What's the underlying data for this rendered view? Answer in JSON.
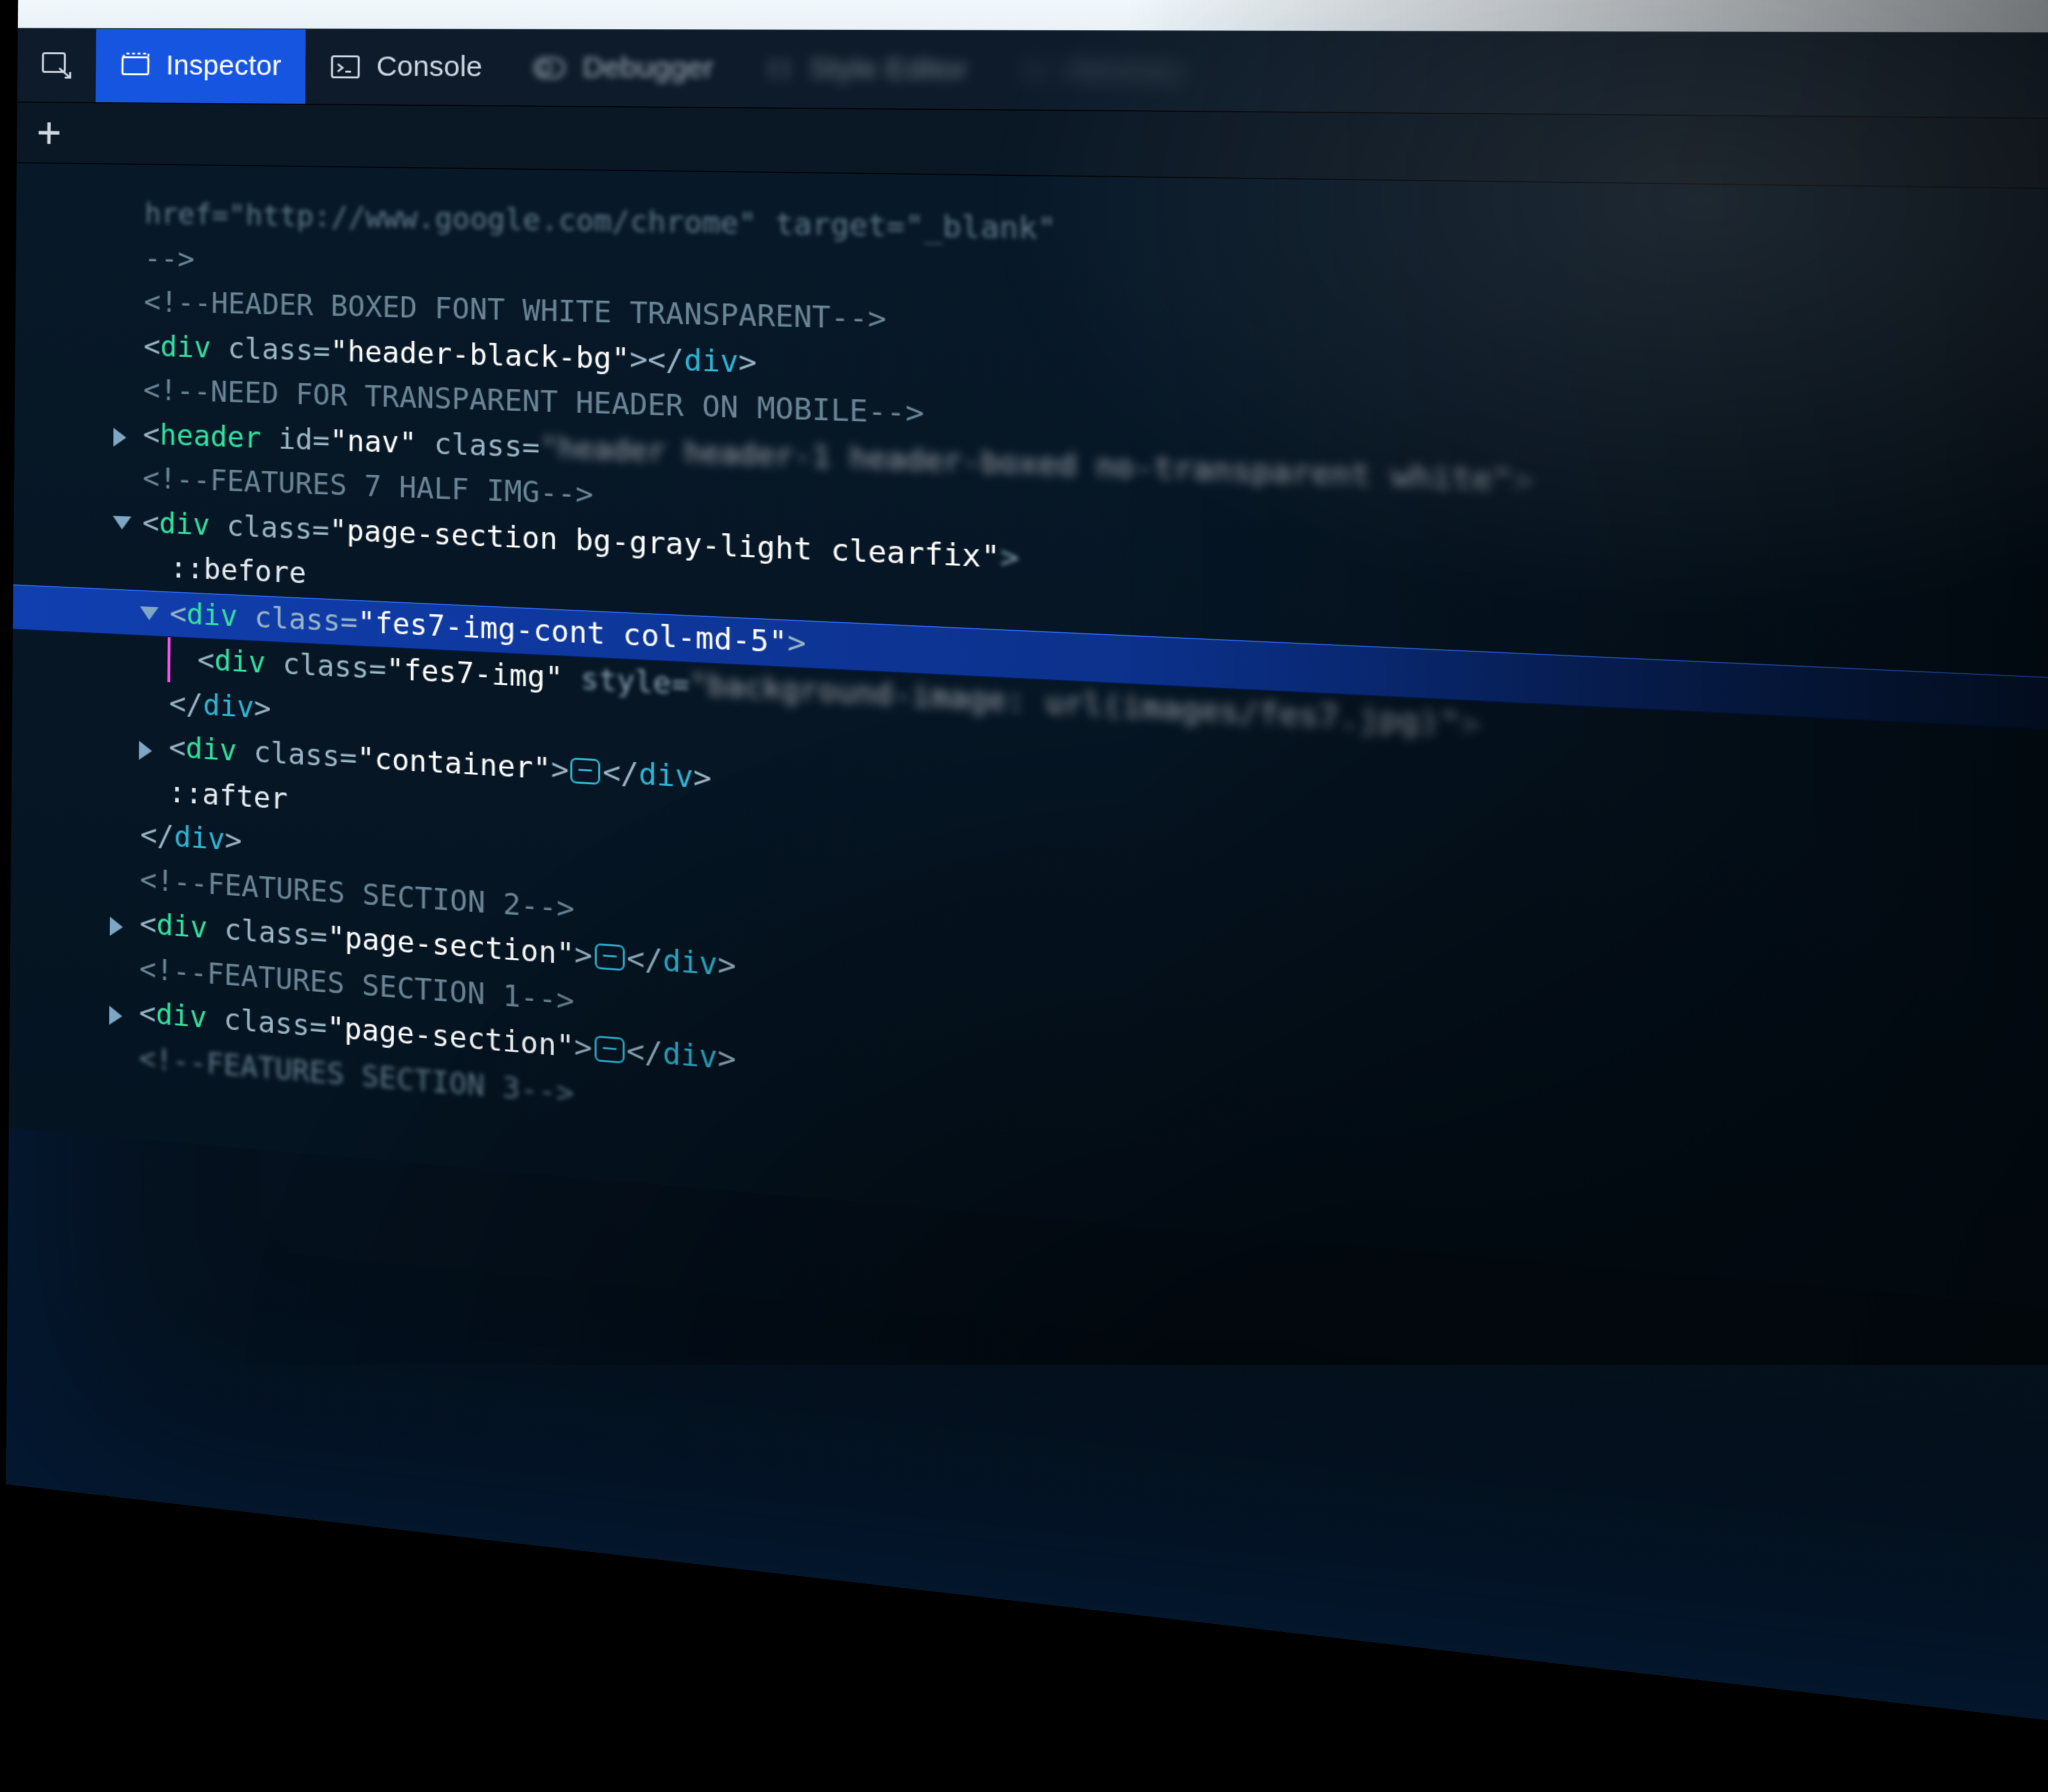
{
  "toolbar": {
    "inspector": "Inspector",
    "console": "Console",
    "debugger": "Debugger",
    "style_editor": "Style Editor",
    "memory": "Memory"
  },
  "code": {
    "l1": "href=\"http://www.google.com/chrome\" target=\"_blank\"",
    "l2": "-->",
    "l3": "<!--HEADER BOXED FONT WHITE TRANSPARENT-->",
    "l4_open": "<",
    "l4_tag": "div",
    "l4_attr": " class=",
    "l4_val": "\"header-black-bg\"",
    "l4_close": "></",
    "l4_tag2": "div",
    "l4_end": ">",
    "l5": "<!--NEED FOR TRANSPARENT HEADER ON MOBILE-->",
    "l6_open": "<",
    "l6_tag": "header",
    "l6_id_attr": " id=",
    "l6_id_val": "\"nav\"",
    "l6_cls_attr": " class=",
    "l6_cls_val": "\"header header-1 header-boxed no-transparent white\"",
    "l6_end": ">",
    "l7": "<!--FEATURES 7 HALF IMG-->",
    "l8_open": "<",
    "l8_tag": "div",
    "l8_attr": " class=",
    "l8_val": "\"page-section bg-gray-light clearfix\"",
    "l8_end": ">",
    "l9": "::before",
    "l10_open": "<",
    "l10_tag": "div",
    "l10_attr": " class=",
    "l10_val": "\"fes7-img-cont col-md-5\"",
    "l10_end": ">",
    "l11_open": "<",
    "l11_tag": "div",
    "l11_attr": " class=",
    "l11_val": "\"fes7-img\"",
    "l11_sty_attr": " style=",
    "l11_sty_val": "\"background-image: url(images/fes7.jpg)\"",
    "l11_end": ">",
    "l12_open": "</",
    "l12_tag": "div",
    "l12_end": ">",
    "l13_open": "<",
    "l13_tag": "div",
    "l13_attr": " class=",
    "l13_val": "\"container\"",
    "l13_mid": ">",
    "l13_close_open": "</",
    "l13_close_tag": "div",
    "l13_close_end": ">",
    "l14": "::after",
    "l15_open": "</",
    "l15_tag": "div",
    "l15_end": ">",
    "l16": "<!--FEATURES SECTION 2-->",
    "l17_open": "<",
    "l17_tag": "div",
    "l17_attr": " class=",
    "l17_val": "\"page-section\"",
    "l17_mid": ">",
    "l17_close_open": "</",
    "l17_close_tag": "div",
    "l17_close_end": ">",
    "l18": "<!--FEATURES SECTION 1-->",
    "l19_open": "<",
    "l19_tag": "div",
    "l19_attr": " class=",
    "l19_val": "\"page-section\"",
    "l19_mid": ">",
    "l19_close_open": "</",
    "l19_close_tag": "div",
    "l19_close_end": ">",
    "l20": "<!--FEATURES SECTION 3-->"
  }
}
